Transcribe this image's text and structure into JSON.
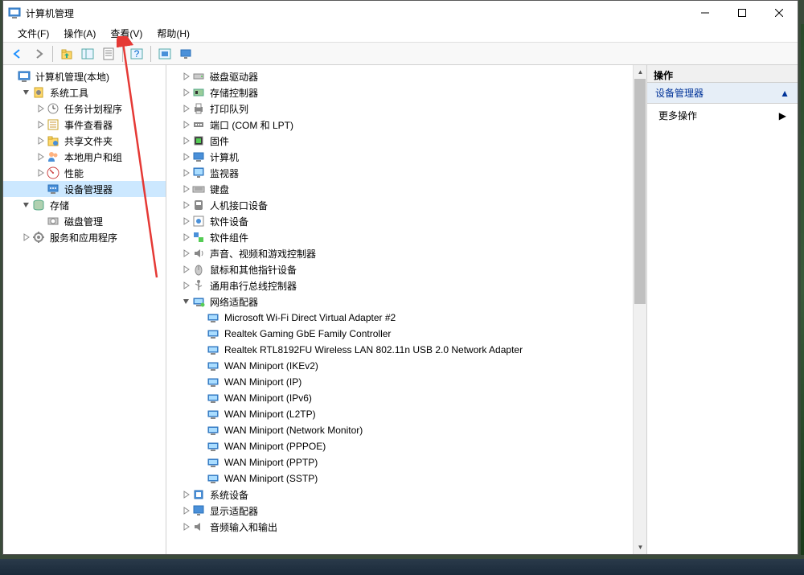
{
  "window": {
    "title": "计算机管理"
  },
  "menu": {
    "file": "文件(F)",
    "action": "操作(A)",
    "view": "查看(V)",
    "help": "帮助(H)"
  },
  "right": {
    "header": "操作",
    "section": "设备管理器",
    "more": "更多操作"
  },
  "leftTree": [
    {
      "indent": 0,
      "exp": "",
      "icon": "mgmt",
      "label": "计算机管理(本地)",
      "sel": false
    },
    {
      "indent": 1,
      "exp": "open",
      "icon": "tools",
      "label": "系统工具",
      "sel": false
    },
    {
      "indent": 2,
      "exp": "closed",
      "icon": "sched",
      "label": "任务计划程序",
      "sel": false
    },
    {
      "indent": 2,
      "exp": "closed",
      "icon": "event",
      "label": "事件查看器",
      "sel": false
    },
    {
      "indent": 2,
      "exp": "closed",
      "icon": "share",
      "label": "共享文件夹",
      "sel": false
    },
    {
      "indent": 2,
      "exp": "closed",
      "icon": "users",
      "label": "本地用户和组",
      "sel": false
    },
    {
      "indent": 2,
      "exp": "closed",
      "icon": "perf",
      "label": "性能",
      "sel": false
    },
    {
      "indent": 2,
      "exp": "",
      "icon": "device",
      "label": "设备管理器",
      "sel": true
    },
    {
      "indent": 1,
      "exp": "open",
      "icon": "storage",
      "label": "存储",
      "sel": false
    },
    {
      "indent": 2,
      "exp": "",
      "icon": "disk",
      "label": "磁盘管理",
      "sel": false
    },
    {
      "indent": 1,
      "exp": "closed",
      "icon": "service",
      "label": "服务和应用程序",
      "sel": false
    }
  ],
  "centerTree": [
    {
      "indent": 0,
      "exp": "closed",
      "icon": "diskdrive",
      "label": "磁盘驱动器"
    },
    {
      "indent": 0,
      "exp": "closed",
      "icon": "storctrl",
      "label": "存储控制器"
    },
    {
      "indent": 0,
      "exp": "closed",
      "icon": "printer",
      "label": "打印队列"
    },
    {
      "indent": 0,
      "exp": "closed",
      "icon": "port",
      "label": "端口 (COM 和 LPT)"
    },
    {
      "indent": 0,
      "exp": "closed",
      "icon": "firmware",
      "label": "固件"
    },
    {
      "indent": 0,
      "exp": "closed",
      "icon": "computer",
      "label": "计算机"
    },
    {
      "indent": 0,
      "exp": "closed",
      "icon": "monitor",
      "label": "监视器"
    },
    {
      "indent": 0,
      "exp": "closed",
      "icon": "keyboard",
      "label": "键盘"
    },
    {
      "indent": 0,
      "exp": "closed",
      "icon": "hid",
      "label": "人机接口设备"
    },
    {
      "indent": 0,
      "exp": "closed",
      "icon": "softdev",
      "label": "软件设备"
    },
    {
      "indent": 0,
      "exp": "closed",
      "icon": "softcomp",
      "label": "软件组件"
    },
    {
      "indent": 0,
      "exp": "closed",
      "icon": "sound",
      "label": "声音、视频和游戏控制器"
    },
    {
      "indent": 0,
      "exp": "closed",
      "icon": "mouse",
      "label": "鼠标和其他指针设备"
    },
    {
      "indent": 0,
      "exp": "closed",
      "icon": "usb",
      "label": "通用串行总线控制器"
    },
    {
      "indent": 0,
      "exp": "open",
      "icon": "network",
      "label": "网络适配器"
    },
    {
      "indent": 1,
      "exp": "",
      "icon": "netadapter",
      "label": "Microsoft Wi-Fi Direct Virtual Adapter #2"
    },
    {
      "indent": 1,
      "exp": "",
      "icon": "netadapter",
      "label": "Realtek Gaming GbE Family Controller"
    },
    {
      "indent": 1,
      "exp": "",
      "icon": "netadapter",
      "label": "Realtek RTL8192FU Wireless LAN 802.11n USB 2.0 Network Adapter"
    },
    {
      "indent": 1,
      "exp": "",
      "icon": "netadapter",
      "label": "WAN Miniport (IKEv2)"
    },
    {
      "indent": 1,
      "exp": "",
      "icon": "netadapter",
      "label": "WAN Miniport (IP)"
    },
    {
      "indent": 1,
      "exp": "",
      "icon": "netadapter",
      "label": "WAN Miniport (IPv6)"
    },
    {
      "indent": 1,
      "exp": "",
      "icon": "netadapter",
      "label": "WAN Miniport (L2TP)"
    },
    {
      "indent": 1,
      "exp": "",
      "icon": "netadapter",
      "label": "WAN Miniport (Network Monitor)"
    },
    {
      "indent": 1,
      "exp": "",
      "icon": "netadapter",
      "label": "WAN Miniport (PPPOE)"
    },
    {
      "indent": 1,
      "exp": "",
      "icon": "netadapter",
      "label": "WAN Miniport (PPTP)"
    },
    {
      "indent": 1,
      "exp": "",
      "icon": "netadapter",
      "label": "WAN Miniport (SSTP)"
    },
    {
      "indent": 0,
      "exp": "closed",
      "icon": "sysdev",
      "label": "系统设备"
    },
    {
      "indent": 0,
      "exp": "closed",
      "icon": "display",
      "label": "显示适配器"
    },
    {
      "indent": 0,
      "exp": "closed",
      "icon": "audio",
      "label": "音频输入和输出"
    }
  ]
}
